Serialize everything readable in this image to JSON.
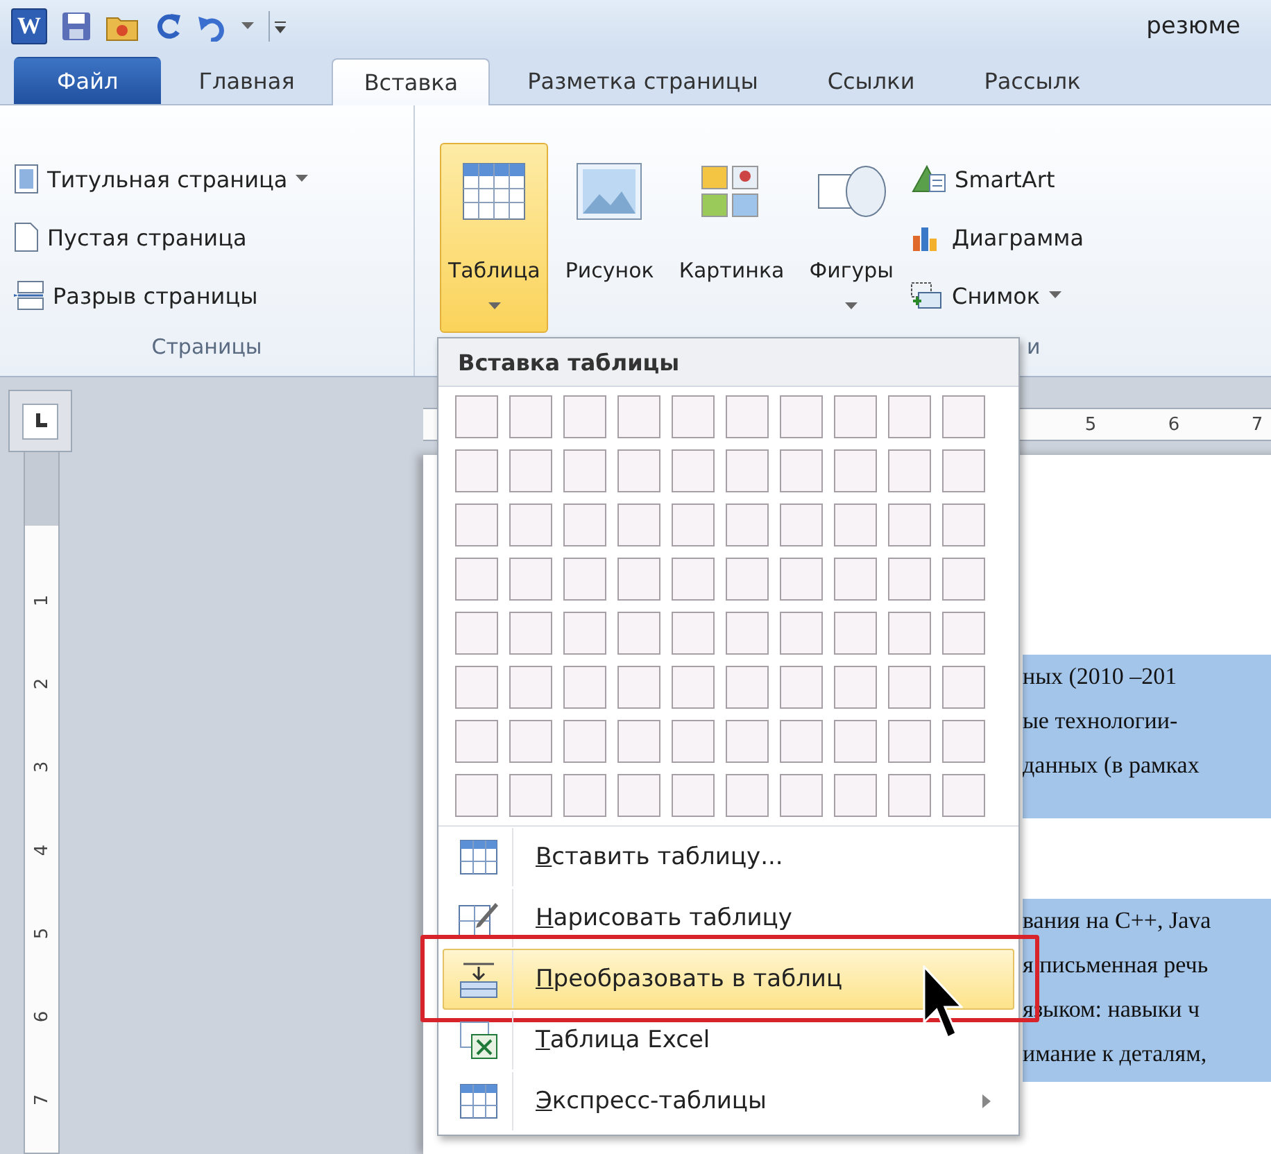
{
  "quick_access": {
    "logo": "W",
    "title": "резюме"
  },
  "tabs": [
    {
      "label": "Файл",
      "kind": "file",
      "selected": false
    },
    {
      "label": "Главная",
      "kind": "tab",
      "selected": false
    },
    {
      "label": "Вставка",
      "kind": "tab",
      "selected": true
    },
    {
      "label": "Разметка страницы",
      "kind": "tab",
      "selected": false
    },
    {
      "label": "Ссылки",
      "kind": "tab",
      "selected": false
    },
    {
      "label": "Рассылк",
      "kind": "tab",
      "selected": false
    }
  ],
  "ribbon": {
    "groups": [
      {
        "label": "Страницы",
        "buttons": [
          {
            "label": "Титульная страница",
            "kind": "small",
            "dropdown": true,
            "active": false
          },
          {
            "label": "Пустая страница",
            "kind": "small",
            "dropdown": false,
            "active": false
          },
          {
            "label": "Разрыв страницы",
            "kind": "small",
            "dropdown": false,
            "active": false
          }
        ]
      },
      {
        "label": "и",
        "buttons": [
          {
            "label": "Таблица",
            "kind": "large",
            "dropdown": true,
            "active": true
          },
          {
            "label": "Рисунок",
            "kind": "large",
            "dropdown": false,
            "active": false
          },
          {
            "label": "Картинка",
            "kind": "large",
            "dropdown": false,
            "active": false
          },
          {
            "label": "Фигуры",
            "kind": "large",
            "dropdown": true,
            "active": false
          },
          {
            "label": "SmartArt",
            "kind": "small",
            "dropdown": false,
            "active": false
          },
          {
            "label": "Диаграмма",
            "kind": "small",
            "dropdown": false,
            "active": false
          },
          {
            "label": "Снимок",
            "kind": "small",
            "dropdown": true,
            "active": false
          }
        ]
      }
    ]
  },
  "ruler": {
    "horizontal": [
      "5",
      "6",
      "7"
    ],
    "vertical": [
      "1",
      "2",
      "3",
      "4",
      "5",
      "6",
      "7"
    ]
  },
  "document": {
    "blocks": [
      {
        "selected": true,
        "lines": [
          "ных (2010 –201",
          "ые технологии-",
          "данных (в рамках"
        ]
      },
      {
        "selected": true,
        "lines": [
          "вания на С++, Java",
          "я письменная речь",
          "языком: навыки ч",
          "имание к деталям,"
        ]
      }
    ]
  },
  "table_menu": {
    "title": "Вставка таблицы",
    "items": [
      {
        "label": "Вставить таблицу...",
        "selected": false,
        "submenu": false
      },
      {
        "label": "Нарисовать таблицу",
        "selected": false,
        "submenu": false
      },
      {
        "label": "Преобразовать в таблиц",
        "selected": true,
        "submenu": false
      },
      {
        "label": "Таблица Excel",
        "selected": false,
        "submenu": false
      },
      {
        "label": "Экспресс-таблицы",
        "selected": false,
        "submenu": true
      }
    ]
  }
}
